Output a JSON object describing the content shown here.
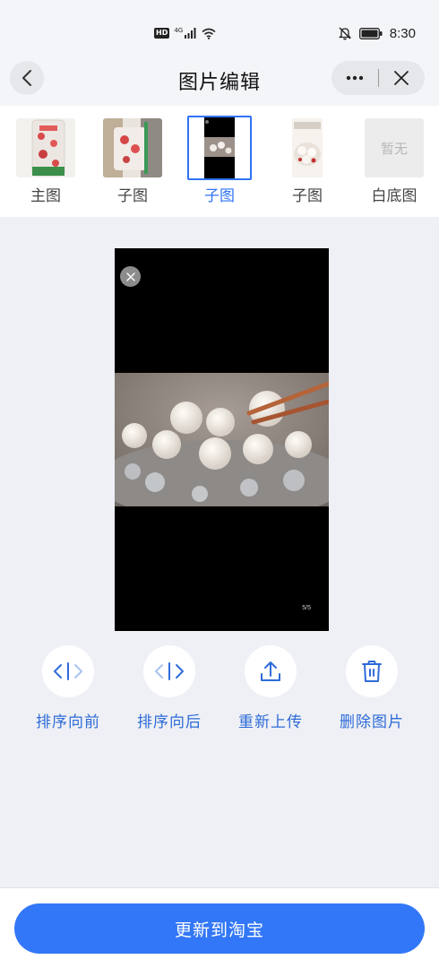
{
  "status_bar": {
    "hd_badge": "HD",
    "network": "4G",
    "time": "8:30",
    "icons": [
      "hd-icon",
      "signal-icon",
      "wifi-icon",
      "mute-icon",
      "battery-icon"
    ]
  },
  "header": {
    "title": "图片编辑",
    "back_icon": "chevron-left-icon",
    "more_icon": "more-icon",
    "close_icon": "close-icon"
  },
  "thumbnails": [
    {
      "label": "主图",
      "selected": false
    },
    {
      "label": "子图",
      "selected": false
    },
    {
      "label": "子图",
      "selected": true
    },
    {
      "label": "子图",
      "selected": false
    },
    {
      "label": "白底图",
      "selected": false,
      "placeholder": "暂无"
    }
  ],
  "preview": {
    "page_indicator": "5/5",
    "remove_icon": "close-circle-icon"
  },
  "actions": [
    {
      "label": "排序向前",
      "icon": "move-forward-icon"
    },
    {
      "label": "排序向后",
      "icon": "move-backward-icon"
    },
    {
      "label": "重新上传",
      "icon": "upload-icon"
    },
    {
      "label": "删除图片",
      "icon": "trash-icon"
    }
  ],
  "footer": {
    "primary_label": "更新到淘宝"
  },
  "colors": {
    "accent": "#3277f7",
    "action_text": "#2f6bd8",
    "page_bg": "#eef0f5"
  }
}
